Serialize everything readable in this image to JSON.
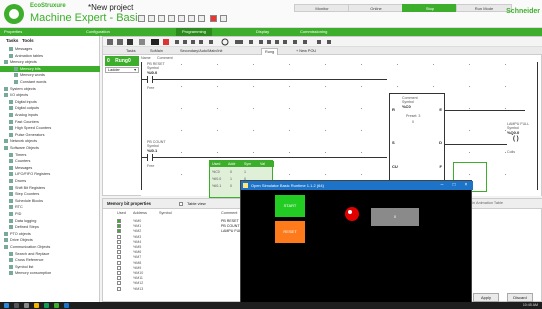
{
  "window": {
    "brand": "EcoStruxure",
    "app_name": "Machine Expert - Basic",
    "project_name": "*New project",
    "vendor": "Schneider",
    "modes": [
      "Monitor",
      "Online",
      "Stop",
      "Run Mode"
    ]
  },
  "ribbon": {
    "tabs": [
      "Properties",
      "Configuration",
      "Programming",
      "Display",
      "Commissioning"
    ],
    "active_index": 2
  },
  "left_panel": {
    "tabs": [
      "Tasks",
      "Tools"
    ],
    "items": [
      {
        "label": "Messages",
        "indent": 1,
        "selected": false
      },
      {
        "label": "Animation tables",
        "indent": 1,
        "selected": false
      },
      {
        "label": "Memory objects",
        "indent": 0,
        "selected": false
      },
      {
        "label": "Memory bits",
        "indent": 2,
        "selected": true
      },
      {
        "label": "Memory words",
        "indent": 2,
        "selected": false
      },
      {
        "label": "Constant words",
        "indent": 2,
        "selected": false
      },
      {
        "label": "System objects",
        "indent": 0,
        "selected": false
      },
      {
        "label": "I/O objects",
        "indent": 0,
        "selected": false
      },
      {
        "label": "Digital inputs",
        "indent": 1,
        "selected": false
      },
      {
        "label": "Digital outputs",
        "indent": 1,
        "selected": false
      },
      {
        "label": "Analog inputs",
        "indent": 1,
        "selected": false
      },
      {
        "label": "Fast Counters",
        "indent": 1,
        "selected": false
      },
      {
        "label": "High Speed Counters",
        "indent": 1,
        "selected": false
      },
      {
        "label": "Pulse Generators",
        "indent": 1,
        "selected": false
      },
      {
        "label": "Network objects",
        "indent": 0,
        "selected": false
      },
      {
        "label": "Software Objects",
        "indent": 0,
        "selected": false
      },
      {
        "label": "Timers",
        "indent": 1,
        "selected": false
      },
      {
        "label": "Counters",
        "indent": 1,
        "selected": false
      },
      {
        "label": "Messages",
        "indent": 1,
        "selected": false
      },
      {
        "label": "LIFO/FIFO Registers",
        "indent": 1,
        "selected": false
      },
      {
        "label": "Drums",
        "indent": 1,
        "selected": false
      },
      {
        "label": "Shift Bit Registers",
        "indent": 1,
        "selected": false
      },
      {
        "label": "Step Counters",
        "indent": 1,
        "selected": false
      },
      {
        "label": "Schedule Blocks",
        "indent": 1,
        "selected": false
      },
      {
        "label": "RTC",
        "indent": 1,
        "selected": false
      },
      {
        "label": "PID",
        "indent": 1,
        "selected": false
      },
      {
        "label": "Data logging",
        "indent": 1,
        "selected": false
      },
      {
        "label": "Defined Steps",
        "indent": 1,
        "selected": false
      },
      {
        "label": "PTO objects",
        "indent": 0,
        "selected": false
      },
      {
        "label": "Drive Objects",
        "indent": 0,
        "selected": false
      },
      {
        "label": "Communication Objects",
        "indent": 0,
        "selected": false
      },
      {
        "label": "Search and Replace",
        "indent": 1,
        "selected": false
      },
      {
        "label": "Cross Reference",
        "indent": 1,
        "selected": false
      },
      {
        "label": "Symbol list",
        "indent": 1,
        "selected": false
      },
      {
        "label": "Memory consumption",
        "indent": 1,
        "selected": false
      }
    ]
  },
  "editor": {
    "tabs": [
      "Tasks",
      "SoMain",
      "Secondary/Auto/Main/Init",
      "Rung",
      "+ New POU"
    ],
    "active_tab": 3,
    "zoom_label": "Undo",
    "rung": {
      "name": "Rung0",
      "number": "0",
      "language": "Ladder",
      "header_labels": [
        "Name",
        "Comment"
      ],
      "contact1": {
        "symbol": "PB RESET",
        "type": "Symbol",
        "addr": "%I0.0",
        "note": "Free"
      },
      "contact2": {
        "symbol": "PB COUNT",
        "type": "Symbol",
        "addr": "%I0.1",
        "note": "Free"
      },
      "counter": {
        "title": "Comment",
        "sub": "Symbol",
        "addr": "%C0",
        "preset_label": "Preset: 3",
        "preset_value": "0",
        "pins": [
          "R",
          "S",
          "D",
          "CU",
          "F",
          "CD"
        ],
        "letter_e": "E"
      },
      "coil": {
        "symbol": "LAMPU FULL",
        "type": "Symbol",
        "addr": "%Q0.0",
        "note": "Coils"
      },
      "mini_table": {
        "headers": [
          "Used",
          "Addr",
          "Sym",
          "Val"
        ],
        "rows": [
          [
            "%C0",
            "0",
            "1",
            ""
          ],
          [
            "%I0.0",
            "1",
            "0",
            ""
          ],
          [
            "%I0.1",
            "0",
            "1",
            ""
          ]
        ]
      }
    }
  },
  "bottom_panel": {
    "title": "Memory bit properties",
    "table_view": "Table view",
    "headers": [
      "Used",
      "Address",
      "Symbol",
      "Comment"
    ],
    "rows": [
      {
        "used": true,
        "address": "%M0",
        "symbol": "",
        "comment": "PB RESET"
      },
      {
        "used": true,
        "address": "%M1",
        "symbol": "",
        "comment": "PB COUNT"
      },
      {
        "used": true,
        "address": "%M2",
        "symbol": "",
        "comment": "LAMPU FULL"
      },
      {
        "used": false,
        "address": "%M3",
        "symbol": "",
        "comment": ""
      },
      {
        "used": false,
        "address": "%M4",
        "symbol": "",
        "comment": ""
      },
      {
        "used": false,
        "address": "%M5",
        "symbol": "",
        "comment": ""
      },
      {
        "used": false,
        "address": "%M6",
        "symbol": "",
        "comment": ""
      },
      {
        "used": false,
        "address": "%M7",
        "symbol": "",
        "comment": ""
      },
      {
        "used": false,
        "address": "%M8",
        "symbol": "",
        "comment": ""
      },
      {
        "used": false,
        "address": "%M9",
        "symbol": "",
        "comment": ""
      },
      {
        "used": false,
        "address": "%M10",
        "symbol": "",
        "comment": ""
      },
      {
        "used": false,
        "address": "%M11",
        "symbol": "",
        "comment": ""
      },
      {
        "used": false,
        "address": "%M12",
        "symbol": "",
        "comment": ""
      },
      {
        "used": false,
        "address": "%M13",
        "symbol": "",
        "comment": ""
      }
    ],
    "apply_label": "Apply",
    "discard_label": "Discard",
    "right_hint": "Allocated in Animation Table"
  },
  "simulator": {
    "title": "Open Simulator Basic Runtime 1.1.2 (64)",
    "button1_label": "START",
    "button2_label": "RESET",
    "display_label": "0",
    "controls": [
      "–",
      "□",
      "×"
    ],
    "colors": {
      "button1": "#22cc22",
      "button2": "#ff7a1a",
      "lamp": "#e00000",
      "display": "#8a8a8a"
    }
  },
  "taskbar": {
    "time": "10:45 AM"
  },
  "colors": {
    "accent": "#3dae2b",
    "title_blue": "#1c73c8"
  }
}
